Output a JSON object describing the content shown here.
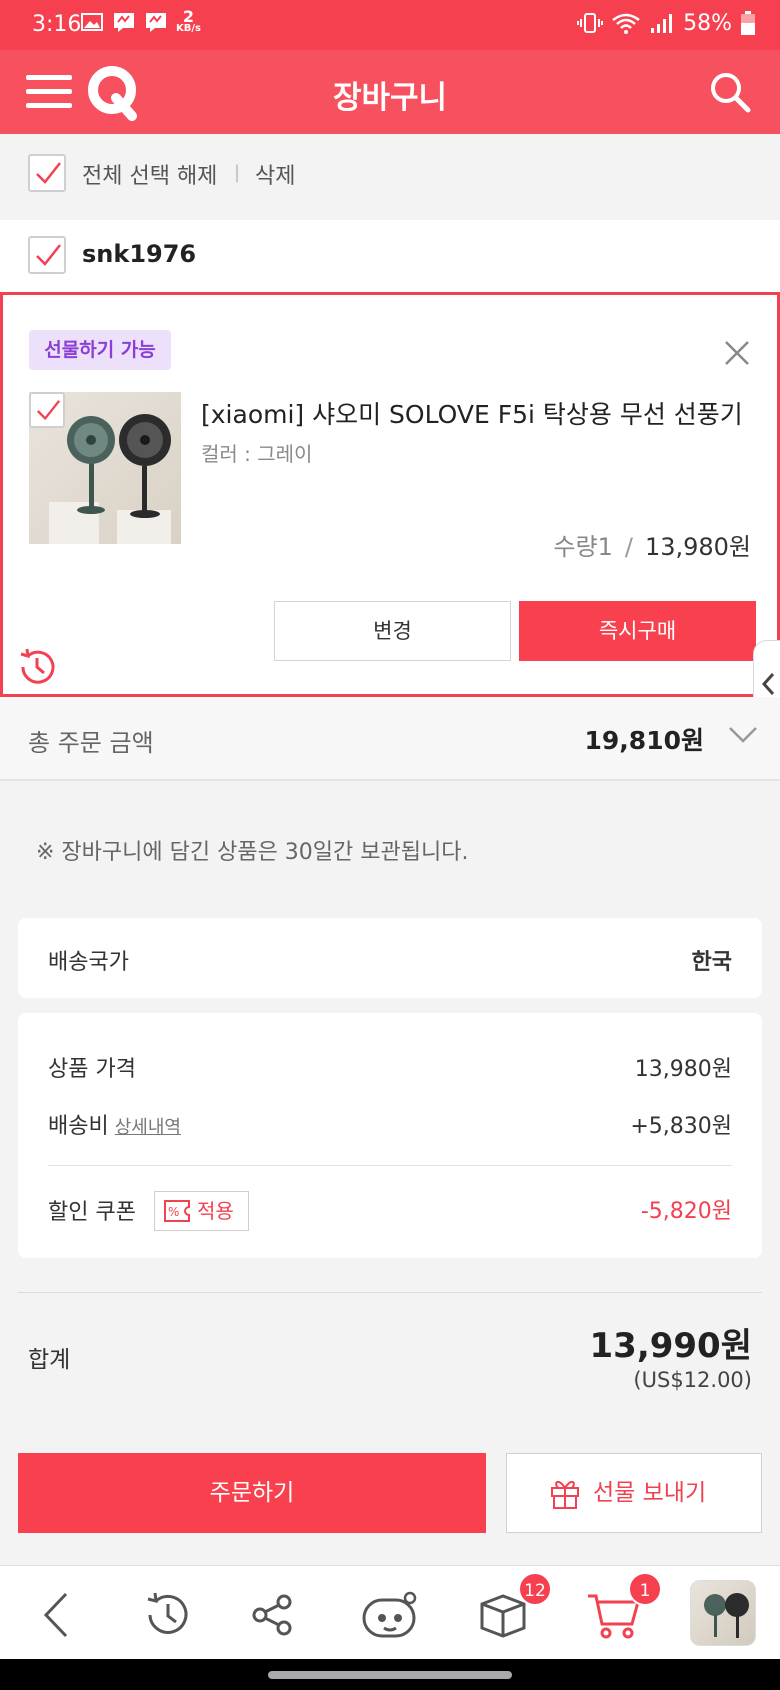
{
  "status_bar": {
    "time": "3:16",
    "speed_value": "2",
    "speed_unit": "KB/s",
    "battery": "58%"
  },
  "header": {
    "title": "장바구니"
  },
  "select_bar": {
    "deselect_all": "전체 선택 해제",
    "separator": "|",
    "delete": "삭제"
  },
  "seller": {
    "name": "snk1976"
  },
  "product": {
    "gift_badge": "선물하기 가능",
    "name": "[xiaomi] 샤오미 SOLOVE F5i 탁상용 무선 선풍기",
    "option": "컬러 : 그레이",
    "quantity": "수량1",
    "separator": "/",
    "price": "13,980원",
    "change_label": "변경",
    "buy_now_label": "즉시구매"
  },
  "total_order": {
    "label": "총 주문 금액",
    "amount": "19,810원"
  },
  "notice": "※ 장바구니에 담긴 상품은 30일간 보관됩니다.",
  "shipping": {
    "label": "배송국가",
    "value": "한국"
  },
  "prices": {
    "item_label": "상품 가격",
    "item_value": "13,980원",
    "shipping_label": "배송비",
    "shipping_detail": "상세내역",
    "shipping_value": "+5,830원",
    "coupon_label": "할인 쿠폰",
    "coupon_apply": "적용",
    "coupon_value": "-5,820원"
  },
  "summary": {
    "label": "합계",
    "total": "13,990원",
    "total_usd": "(US$12.00)"
  },
  "actions": {
    "order": "주문하기",
    "gift": "선물 보내기"
  },
  "bottom_nav": {
    "box_badge": "12",
    "cart_badge": "1"
  },
  "colors": {
    "brand": "#f7404f",
    "accent_purple": "#8a3fd6",
    "badge_bg": "#ede0fb"
  }
}
